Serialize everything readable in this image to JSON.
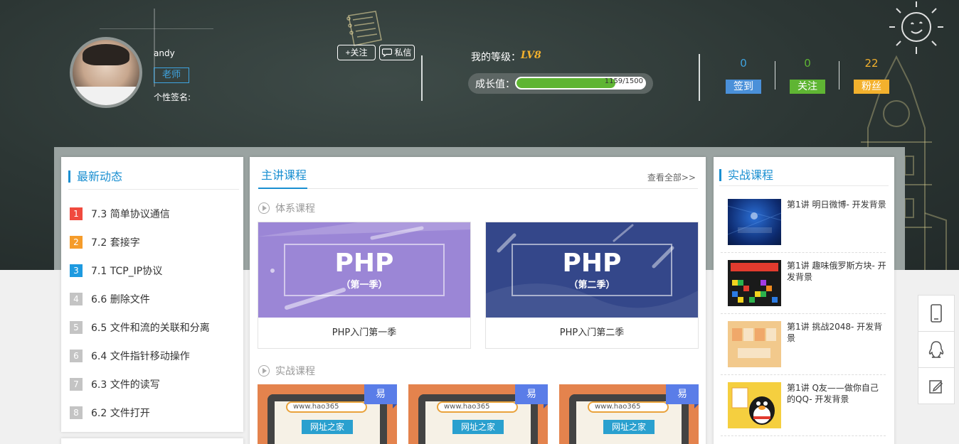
{
  "profile": {
    "username": "andy",
    "role": "老师",
    "signature_label": "个性签名:",
    "follow_label": "+关注",
    "message_label": "私信"
  },
  "level": {
    "label": "我的等级：",
    "value": "LV8",
    "growth_label": "成长值：",
    "growth_text": "1159/1500",
    "growth_progress": 0.773
  },
  "stats": [
    {
      "count": "0",
      "label": "签到",
      "color": "#4a90d9",
      "count_color": "#3fa4e0"
    },
    {
      "count": "0",
      "label": "关注",
      "color": "#5fb533",
      "count_color": "#5fb533"
    },
    {
      "count": "22",
      "label": "粉丝",
      "color": "#f3b12d",
      "count_color": "#f3b12d"
    }
  ],
  "news": {
    "title": "最新动态",
    "items": [
      {
        "num": "1",
        "text": "7.3 简单协议通信",
        "color": "#f04a3e"
      },
      {
        "num": "2",
        "text": "7.2 套接字",
        "color": "#f59c2b"
      },
      {
        "num": "3",
        "text": "7.1 TCP_IP协议",
        "color": "#1e9ae0"
      },
      {
        "num": "4",
        "text": "6.6 删除文件",
        "color": "#c4c4c4"
      },
      {
        "num": "5",
        "text": "6.5 文件和流的关联和分离",
        "color": "#c4c4c4"
      },
      {
        "num": "6",
        "text": "6.4 文件指针移动操作",
        "color": "#c4c4c4"
      },
      {
        "num": "7",
        "text": "6.3 文件的读写",
        "color": "#c4c4c4"
      },
      {
        "num": "8",
        "text": "6.2 文件打开",
        "color": "#c4c4c4"
      }
    ]
  },
  "courses": {
    "tab": "主讲课程",
    "view_all": "查看全部>>",
    "system_head": "体系课程",
    "practical_head": "实战课程",
    "system_courses": [
      {
        "thumb_big": "PHP",
        "thumb_small": "（第一季）",
        "name": "PHP入门第一季",
        "bg": "#9b86d6"
      },
      {
        "thumb_big": "PHP",
        "thumb_small": "（第二季）",
        "name": "PHP入门第二季",
        "bg": "#34478a"
      }
    ],
    "practical_courses": [
      {
        "badge": "易",
        "search": "www.hao365",
        "site": "网址之家"
      },
      {
        "badge": "易",
        "search": "www.hao365",
        "site": "网址之家"
      },
      {
        "badge": "易",
        "search": "www.hao365",
        "site": "网址之家"
      }
    ]
  },
  "practice": {
    "title": "实战课程",
    "items": [
      {
        "title": "第1讲 明日微博- 开发背景",
        "thumb": "weibo"
      },
      {
        "title": "第1讲 趣味俄罗斯方块- 开发背景",
        "thumb": "tetris"
      },
      {
        "title": "第1讲 挑战2048- 开发背景",
        "thumb": "2048"
      },
      {
        "title": "第1讲 Q友——做你自己的QQ- 开发背景",
        "thumb": "qq"
      }
    ]
  },
  "side_tools": [
    {
      "icon": "phone-icon"
    },
    {
      "icon": "qq-icon"
    },
    {
      "icon": "edit-icon"
    }
  ]
}
